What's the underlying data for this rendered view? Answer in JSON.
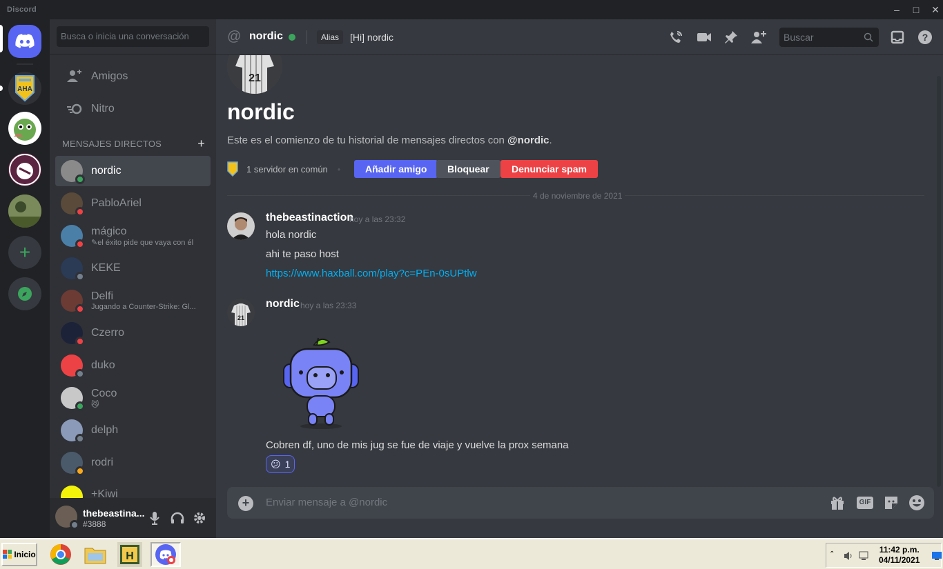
{
  "window": {
    "title": "Discord",
    "min": "–",
    "max": "□",
    "close": "✕"
  },
  "sidebar": {
    "search_placeholder": "Busca o inicia una conversación",
    "nav": [
      {
        "label": "Amigos"
      },
      {
        "label": "Nitro"
      }
    ],
    "dm_header": "MENSAJES DIRECTOS",
    "dm_add": "+",
    "dms": [
      {
        "name": "nordic",
        "sub": "",
        "status": "online",
        "color": "#8a8a8a"
      },
      {
        "name": "PabloAriel",
        "sub": "",
        "status": "dnd",
        "color": "#5a4a3a"
      },
      {
        "name": "mágico",
        "sub": "✎el éxito pide que vaya con él",
        "status": "dnd",
        "color": "#4a7fa8"
      },
      {
        "name": "KEKE",
        "sub": "",
        "status": "offline",
        "color": "#2b3a55"
      },
      {
        "name": "Delfi",
        "sub": "Jugando a Counter-Strike: Gl...",
        "status": "dnd",
        "color": "#6b3b34"
      },
      {
        "name": "Czerro",
        "sub": "",
        "status": "dnd",
        "color": "#1c2238"
      },
      {
        "name": "duko",
        "sub": "",
        "status": "offline",
        "color": "#ed4245"
      },
      {
        "name": "Coco",
        "sub": "😼",
        "status": "online",
        "color": "#c8c8c8"
      },
      {
        "name": "delph",
        "sub": "",
        "status": "offline",
        "color": "#8a9ab8"
      },
      {
        "name": "rodri",
        "sub": "",
        "status": "idle",
        "color": "#4a5a6a"
      },
      {
        "name": "+Kiwi",
        "sub": "",
        "status": "none",
        "color": "#f2f20a"
      }
    ]
  },
  "user": {
    "name": "thebeastina...",
    "tag": "#3888"
  },
  "header": {
    "channel_name": "nordic",
    "alias_label": "Alias",
    "alias_value": "[Hi] nordic",
    "search_placeholder": "Buscar"
  },
  "intro": {
    "title": "nordic",
    "desc_prefix": "Este es el comienzo de tu historial de mensajes directos con ",
    "desc_user": "@nordic",
    "desc_suffix": ".",
    "mutual": "1 servidor en común",
    "btn_add": "Añadir amigo",
    "btn_block": "Bloquear",
    "btn_spam": "Denunciar spam"
  },
  "date_divider": "4 de noviembre de 2021",
  "messages": [
    {
      "author": "thebeastinaction",
      "time": "hoy a las 23:32",
      "lines": [
        "hola nordic",
        "ahi te paso host"
      ],
      "link": "https://www.haxball.com/play?c=PEn-0sUPtlw"
    },
    {
      "author": "nordic",
      "time": "hoy a las 23:33",
      "text": "Cobren df, uno de mis jug se fue de viaje y vuelve la prox semana",
      "reaction": {
        "emoji": "😕",
        "count": "1"
      }
    }
  ],
  "composer": {
    "placeholder": "Enviar mensaje a @nordic",
    "gif_label": "GIF"
  },
  "taskbar": {
    "start": "Inicio",
    "time": "11:42 p.m.",
    "date": "04/11/2021"
  },
  "colors": {
    "blurple": "#5865f2",
    "danger": "#ed4245",
    "online": "#3ba55d",
    "link": "#00b0f4"
  }
}
